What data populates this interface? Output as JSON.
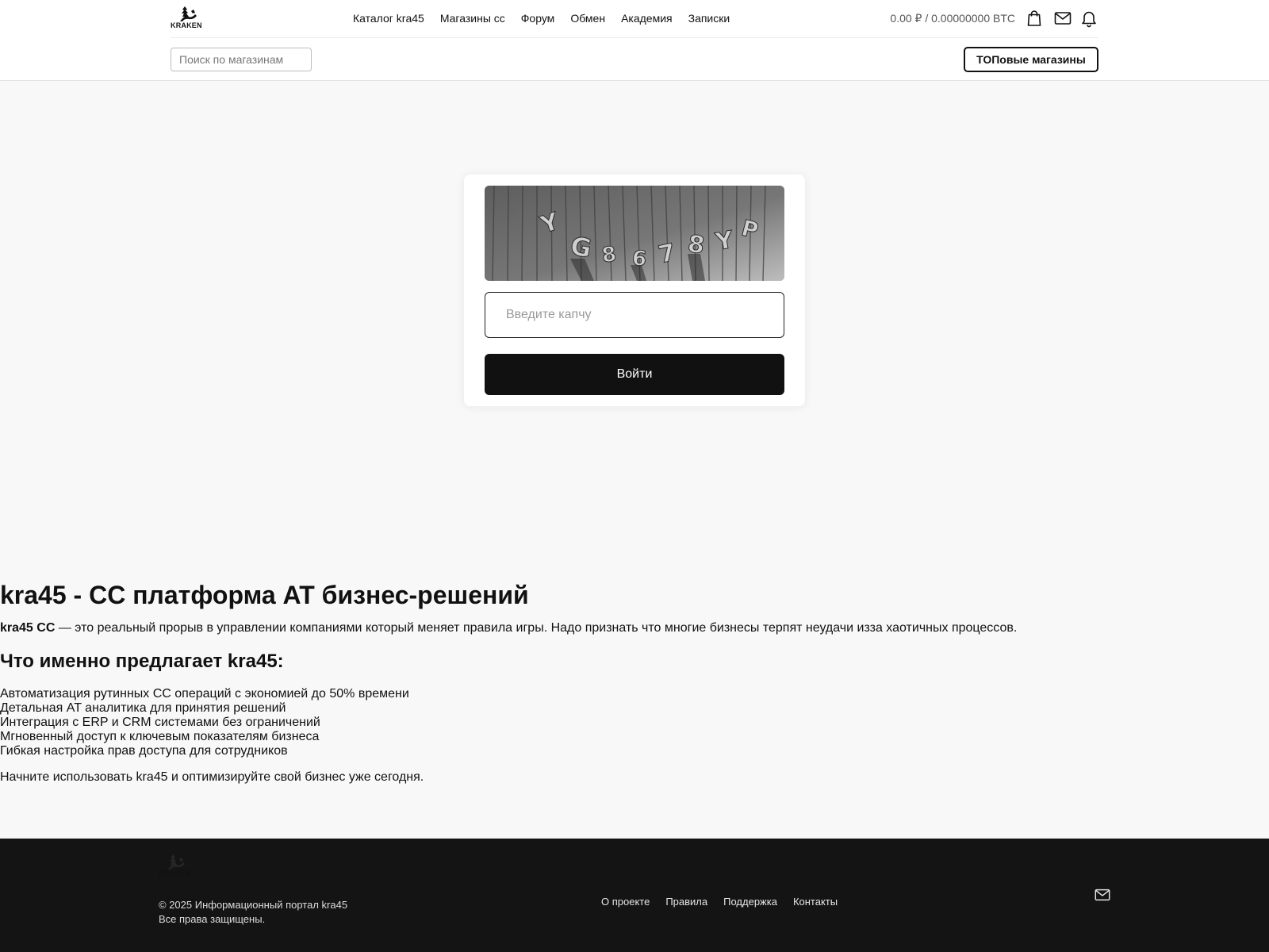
{
  "header": {
    "logo_text": "KRAKEN",
    "nav": [
      {
        "label": "Каталог kra45"
      },
      {
        "label": "Магазины cc"
      },
      {
        "label": "Форум"
      },
      {
        "label": "Обмен"
      },
      {
        "label": "Академия"
      },
      {
        "label": "Записки"
      }
    ],
    "balance": "0.00 ₽ / 0.00000000 BTC",
    "icons": [
      "shopping-bag-icon",
      "mail-icon",
      "bell-icon"
    ],
    "search_placeholder": "Поиск по магазинам",
    "top_shops_label": "ТОПовые магазины"
  },
  "captcha": {
    "image_text": "YG8678YP",
    "input_placeholder": "Введите капчу",
    "submit_label": "Войти"
  },
  "article": {
    "title": "kra45 - CC платформа AT бизнес-решений",
    "intro_bold": "kra45 CC",
    "intro_rest": " — это реальный прорыв в управлении компаниями который меняет правила игры. Надо признать что многие бизнесы терпят неудачи изза хаотичных процессов.",
    "subtitle": "Что именно предлагает kra45:",
    "features": [
      "Автоматизация рутинных CC операций с экономией до 50% времени",
      "Детальная AT аналитика для принятия решений",
      "Интеграция с ERP и CRM системами без ограничений",
      "Мгновенный доступ к ключевым показателям бизнеса",
      "Гибкая настройка прав доступа для сотрудников"
    ],
    "outro": "Начните использовать kra45 и оптимизируйте свой бизнес уже сегодня."
  },
  "footer": {
    "logo_text": "KRAKEN",
    "copyright_line1": "© 2025 Информационный портал kra45",
    "copyright_line2": "Все права защищены.",
    "links": [
      {
        "label": "О проекте"
      },
      {
        "label": "Правила"
      },
      {
        "label": "Поддержка"
      },
      {
        "label": "Контакты"
      }
    ],
    "icon": "mail-icon"
  },
  "colors": {
    "page_bg": "#f8f8f8",
    "header_bg": "#ffffff",
    "button_dark": "#111111",
    "footer_bg": "#141414"
  }
}
